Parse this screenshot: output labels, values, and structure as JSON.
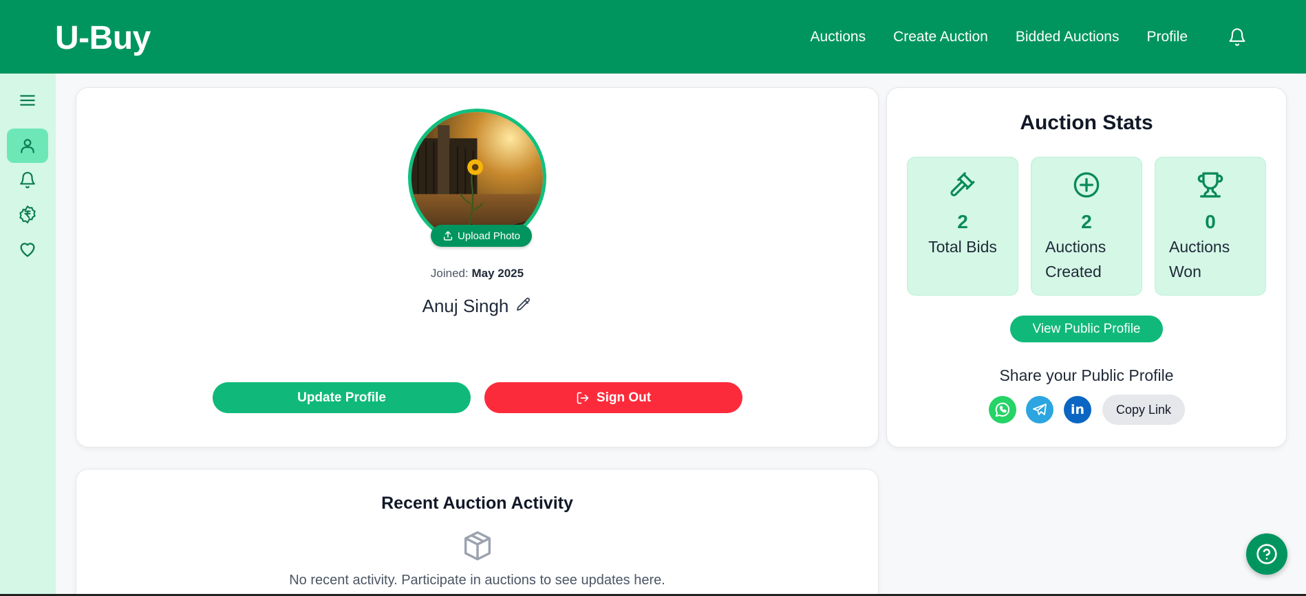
{
  "app": {
    "brand": "U-Buy"
  },
  "nav": {
    "items": [
      "Auctions",
      "Create Auction",
      "Bidded Auctions",
      "Profile"
    ]
  },
  "sidebar": {
    "icons": [
      "menu-icon",
      "user-icon",
      "bell-icon",
      "rupee-icon",
      "heart-icon"
    ],
    "active": "user-icon"
  },
  "profile": {
    "upload_label": "Upload Photo",
    "joined_label": "Joined:",
    "joined_value": "May 2025",
    "name": "Anuj Singh",
    "update_label": "Update Profile",
    "signout_label": "Sign Out"
  },
  "stats": {
    "title": "Auction Stats",
    "tiles": [
      {
        "icon": "gavel-icon",
        "value": "2",
        "label": "Total Bids"
      },
      {
        "icon": "plus-circle-icon",
        "value": "2",
        "label": "Auctions Created"
      },
      {
        "icon": "trophy-icon",
        "value": "0",
        "label": "Auctions Won"
      }
    ],
    "public_profile_label": "View Public Profile",
    "share_title": "Share your Public Profile",
    "share_icons": [
      "whatsapp-icon",
      "telegram-icon",
      "linkedin-icon"
    ],
    "copy_label": "Copy Link"
  },
  "activity": {
    "title": "Recent Auction Activity",
    "empty_text": "No recent activity. Participate in auctions to see updates here."
  },
  "colors": {
    "header": "#00955f",
    "accent": "#10b97a",
    "danger": "#fc2b3b",
    "sidebar": "#d4f7e6"
  }
}
